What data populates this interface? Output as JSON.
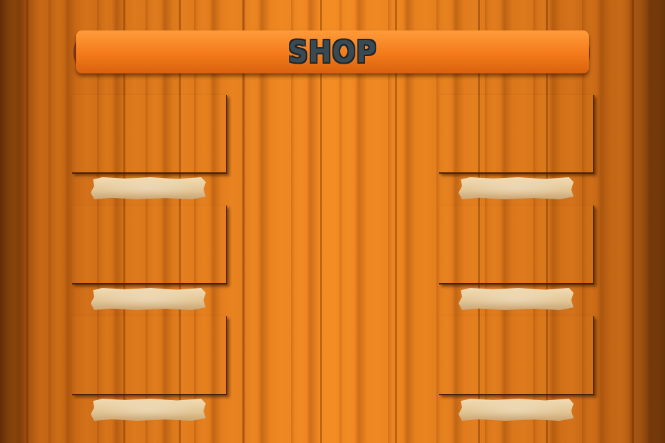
{
  "header": {
    "title": "SHOP"
  },
  "colors": {
    "wood": "#f38a22",
    "banner": "#f47a1a",
    "banner_end": "#8a3a1a",
    "title_text": "#3a4a52",
    "tag": "#e2c595"
  },
  "shop_items": [
    {
      "label": ""
    },
    {
      "label": ""
    },
    {
      "label": ""
    },
    {
      "label": ""
    },
    {
      "label": ""
    },
    {
      "label": ""
    }
  ]
}
